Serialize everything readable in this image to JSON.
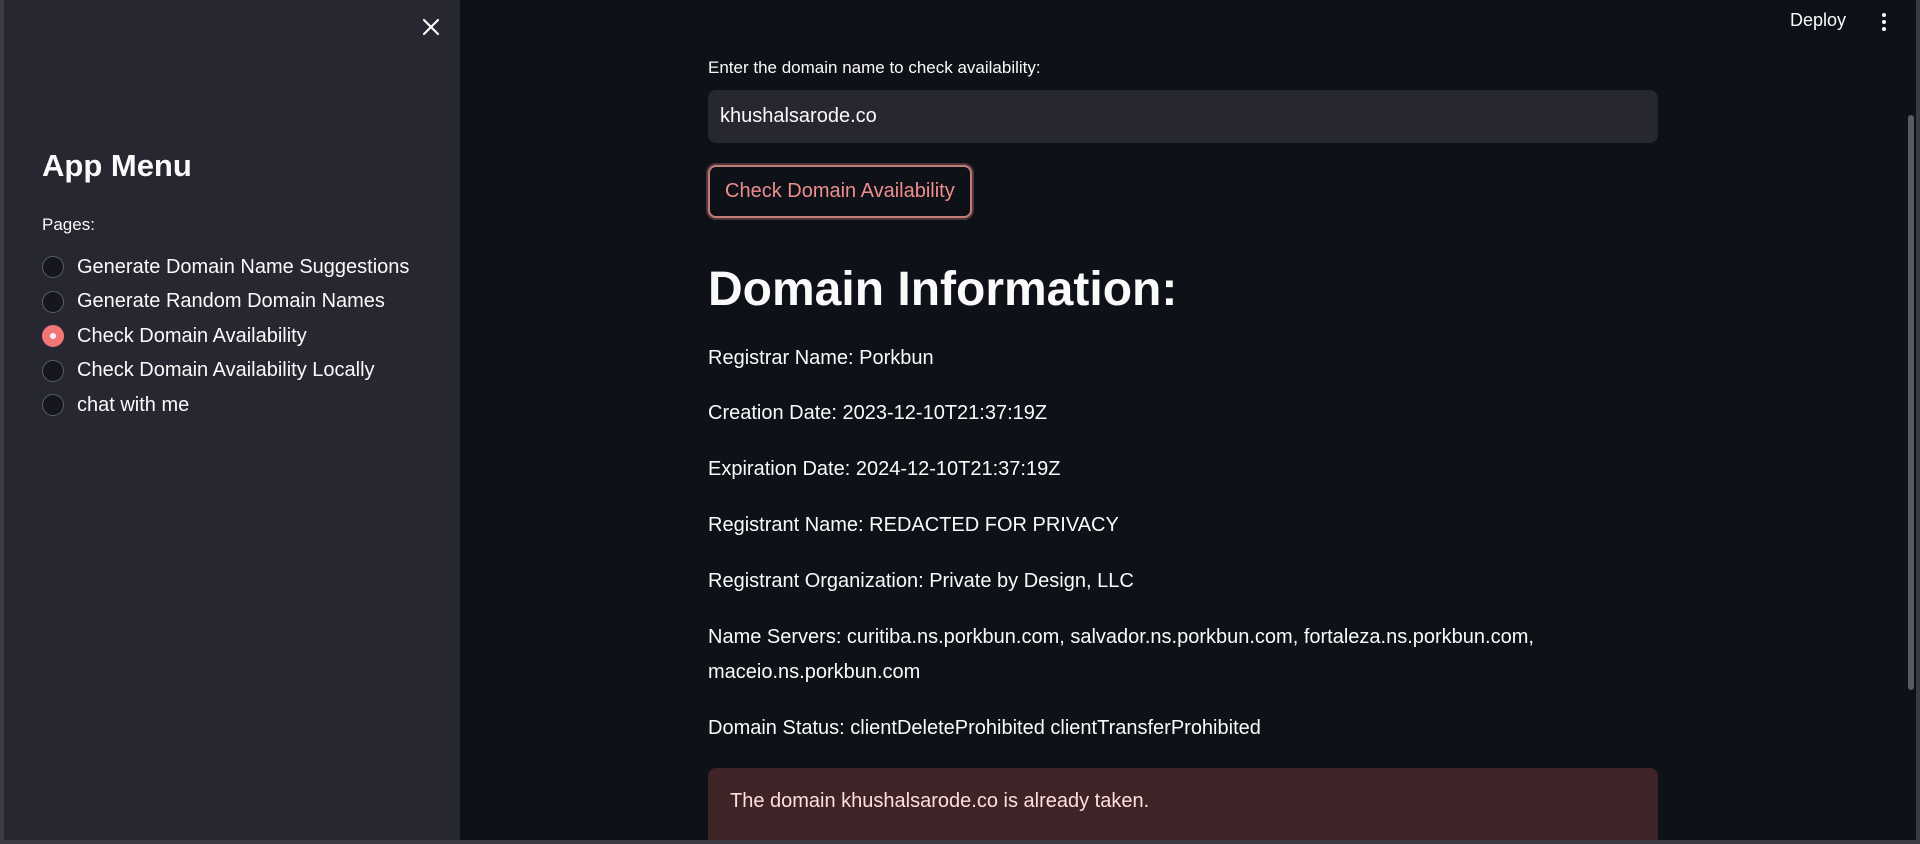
{
  "sidebar": {
    "title": "App Menu",
    "pages_label": "Pages:",
    "items": [
      {
        "label": "Generate Domain Name Suggestions",
        "selected": false
      },
      {
        "label": "Generate Random Domain Names",
        "selected": false
      },
      {
        "label": "Check Domain Availability",
        "selected": true
      },
      {
        "label": "Check Domain Availability Locally",
        "selected": false
      },
      {
        "label": "chat with me",
        "selected": false
      }
    ]
  },
  "header": {
    "deploy_label": "Deploy"
  },
  "main": {
    "input_label": "Enter the domain name to check availability:",
    "input_value": "khushalsarode.co",
    "check_button_label": "Check Domain Availability",
    "heading": "Domain Information:",
    "info": {
      "registrar": "Registrar Name: Porkbun",
      "creation": "Creation Date: 2023-12-10T21:37:19Z",
      "expiration": "Expiration Date: 2024-12-10T21:37:19Z",
      "registrant_name": "Registrant Name: REDACTED FOR PRIVACY",
      "registrant_org": "Registrant Organization: Private by Design, LLC",
      "name_servers_line1": "Name Servers: curitiba.ns.porkbun.com, salvador.ns.porkbun.com, fortaleza.ns.porkbun.com,",
      "name_servers_line2": "maceio.ns.porkbun.com",
      "domain_status": "Domain Status: clientDeleteProhibited clientTransferProhibited"
    },
    "alert": "The domain khushalsarode.co is already taken."
  },
  "colors": {
    "background": "#0e1117",
    "sidebar": "#262730",
    "accent": "#ff7b7b",
    "error_bg": "#3e2327"
  }
}
